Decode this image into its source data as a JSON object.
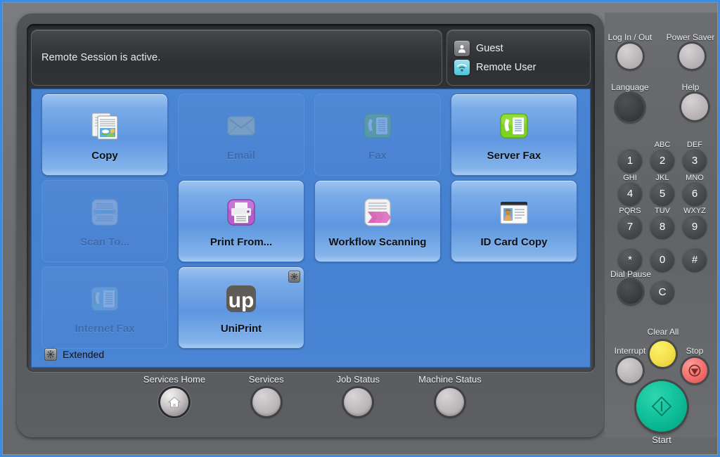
{
  "status": {
    "message": "Remote Session is active.",
    "users": [
      {
        "label": "Guest",
        "icon": "user-icon"
      },
      {
        "label": "Remote User",
        "icon": "remote-user-icon"
      }
    ]
  },
  "services": {
    "tiles": [
      {
        "label": "Copy",
        "icon": "copy-icon",
        "enabled": true,
        "badge": false
      },
      {
        "label": "Email",
        "icon": "email-envelope-icon",
        "enabled": false,
        "badge": false
      },
      {
        "label": "Fax",
        "icon": "fax-icon",
        "enabled": false,
        "badge": false
      },
      {
        "label": "Server Fax",
        "icon": "server-fax-icon",
        "enabled": true,
        "badge": false
      },
      {
        "label": "Scan To...",
        "icon": "scan-to-icon",
        "enabled": false,
        "badge": false
      },
      {
        "label": "Print From...",
        "icon": "print-from-icon",
        "enabled": true,
        "badge": false
      },
      {
        "label": "Workflow Scanning",
        "icon": "workflow-scanning-icon",
        "enabled": true,
        "badge": false
      },
      {
        "label": "ID Card Copy",
        "icon": "id-card-copy-icon",
        "enabled": true,
        "badge": false
      },
      {
        "label": "Internet Fax",
        "icon": "internet-fax-icon",
        "enabled": false,
        "badge": false
      },
      {
        "label": "UniPrint",
        "icon": "uniprint-icon",
        "enabled": true,
        "badge": true
      },
      {
        "label": "",
        "icon": "",
        "enabled": null,
        "badge": false
      },
      {
        "label": "",
        "icon": "",
        "enabled": null,
        "badge": false
      }
    ],
    "extended": {
      "label": "Extended",
      "icon": "gear-badge-icon"
    }
  },
  "bottom_nav": [
    {
      "label": "Services Home",
      "icon": "home-icon",
      "active": true
    },
    {
      "label": "Services",
      "icon": "blank-button",
      "active": false
    },
    {
      "label": "Job Status",
      "icon": "blank-button",
      "active": false
    },
    {
      "label": "Machine Status",
      "icon": "blank-button",
      "active": false
    }
  ],
  "right_panel": {
    "top_buttons": [
      {
        "label": "Log In / Out",
        "style": "light"
      },
      {
        "label": "Power Saver",
        "style": "light"
      },
      {
        "label": "Language",
        "style": "dark"
      },
      {
        "label": "Help",
        "style": "light"
      }
    ],
    "keypad": [
      {
        "digit": "1",
        "letters": ""
      },
      {
        "digit": "2",
        "letters": "ABC"
      },
      {
        "digit": "3",
        "letters": "DEF"
      },
      {
        "digit": "4",
        "letters": "GHI"
      },
      {
        "digit": "5",
        "letters": "JKL"
      },
      {
        "digit": "6",
        "letters": "MNO"
      },
      {
        "digit": "7",
        "letters": "PQRS"
      },
      {
        "digit": "8",
        "letters": "TUV"
      },
      {
        "digit": "9",
        "letters": "WXYZ"
      },
      {
        "digit": "*",
        "letters": ""
      },
      {
        "digit": "0",
        "letters": ""
      },
      {
        "digit": "#",
        "letters": ""
      }
    ],
    "dial_pause_label": "Dial Pause",
    "clear_key_label": "C",
    "clear_all_label": "Clear All",
    "interrupt_label": "Interrupt",
    "stop_label": "Stop",
    "start_label": "Start"
  },
  "colors": {
    "panel_blue": "#4a85d4",
    "tile_enabled": "#7aabe8",
    "tile_disabled": "#5189d6",
    "clear_all_yellow": "#f5e14e",
    "stop_red": "#f4726e",
    "start_teal": "#14c49e",
    "bezel_gray": "#6b6d70"
  }
}
